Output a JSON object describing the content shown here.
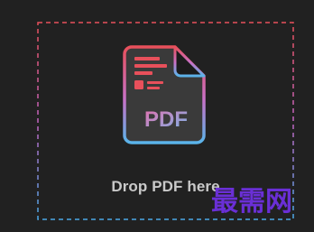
{
  "drop_zone": {
    "label": "Drop PDF here",
    "icon": "pdf-file-icon",
    "icon_text": "PDF",
    "border_gradient": [
      "#e8505b",
      "#c85ab8",
      "#4aa8e6"
    ]
  },
  "colors": {
    "background": "#212121",
    "label": "#c9c9c9",
    "icon_lines": "#e8505b",
    "icon_text_gradient": [
      "#e46fae",
      "#7ab6ea"
    ]
  },
  "watermark": {
    "text": "最需网"
  }
}
